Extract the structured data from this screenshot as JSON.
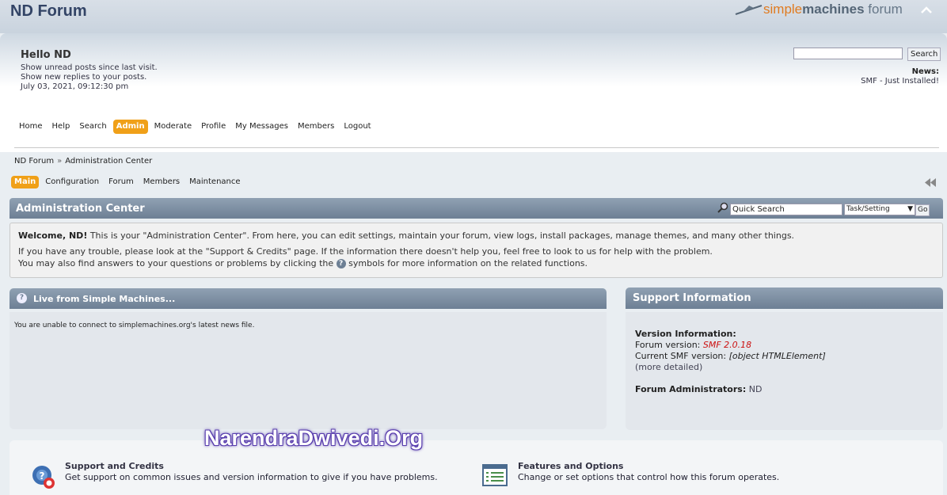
{
  "header": {
    "forum_title": "ND Forum",
    "logo_part1": "simple",
    "logo_part2": "machines",
    "logo_part3": " forum"
  },
  "user": {
    "greeting": "Hello ND",
    "unread_link": "Show unread posts since last visit.",
    "replies_link": "Show new replies to your posts.",
    "datetime": "July 03, 2021, 09:12:30 pm"
  },
  "search": {
    "button_label": "Search",
    "value": ""
  },
  "news": {
    "label": "News:",
    "text": "SMF - Just Installed!"
  },
  "main_menu": [
    "Home",
    "Help",
    "Search",
    "Admin",
    "Moderate",
    "Profile",
    "My Messages",
    "Members",
    "Logout"
  ],
  "main_menu_active": "Admin",
  "breadcrumb": {
    "items": [
      "ND Forum",
      "Administration Center"
    ],
    "separator": "»"
  },
  "admin_tabs": [
    "Main",
    "Configuration",
    "Forum",
    "Members",
    "Maintenance"
  ],
  "admin_tabs_active": "Main",
  "admin_bar": {
    "title": "Administration Center",
    "quick_search_value": "Quick Search",
    "select_value": "Task/Setting",
    "go_label": "Go"
  },
  "welcome": {
    "bold": "Welcome, ND!",
    "line1_rest": " This is your \"Administration Center\". From here, you can edit settings, maintain your forum, view logs, install packages, manage themes, and many other things.",
    "line2": "If you have any trouble, please look at the \"Support & Credits\" page. If the information there doesn't help you, feel free to look to us for help with the problem.",
    "line3_pre": "You may also find answers to your questions or problems by clicking the ",
    "line3_post": " symbols for more information on the related functions."
  },
  "live": {
    "title": "Live from Simple Machines...",
    "message": "You are unable to connect to simplemachines.org's latest news file."
  },
  "support": {
    "title": "Support Information",
    "version_heading": "Version Information:",
    "forum_version_label": "Forum version: ",
    "forum_version_value": "SMF 2.0.18",
    "current_version_label": "Current SMF version: ",
    "current_version_value": "[object HTMLElement]",
    "more_detailed": "(more detailed)",
    "admins_label": "Forum Administrators:",
    "admins_value": " ND"
  },
  "bottom": {
    "support_title": "Support and Credits",
    "support_desc": "Get support on common issues and version information to give if you have problems.",
    "features_title": "Features and Options",
    "features_desc": "Change or set options that control how this forum operates."
  },
  "watermark": "NarendraDwivedi.Org",
  "colors": {
    "accent": "#f0a018",
    "bar": "#6d7f94",
    "version_red": "#cc1111"
  }
}
